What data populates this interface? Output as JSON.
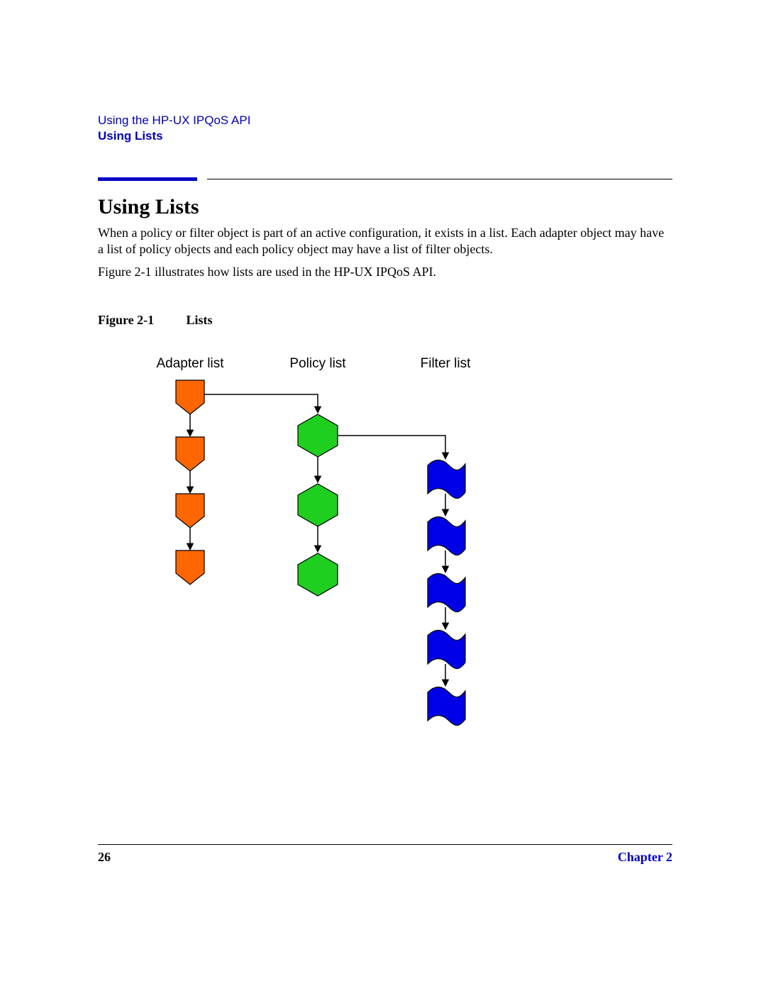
{
  "header": {
    "chapter_path": "Using the HP-UX IPQoS API",
    "section": "Using Lists"
  },
  "section_title": "Using Lists",
  "paragraphs": {
    "p1": "When a policy or filter object is part of an active configuration, it exists in a list. Each adapter object may have a list of policy objects and each policy object may have a list of filter objects.",
    "p2": "Figure 2-1 illustrates how lists are used in the HP-UX IPQoS API."
  },
  "figure": {
    "label": "Figure 2-1",
    "title": "Lists",
    "columns": {
      "adapter": "Adapter list",
      "policy": "Policy list",
      "filter": "Filter list"
    }
  },
  "footer": {
    "page_number": "26",
    "chapter_ref": "Chapter 2"
  },
  "colors": {
    "adapter_fill": "#ff6600",
    "policy_fill": "#1fcf1f",
    "filter_fill": "#0000e6",
    "accent": "#0000c8"
  }
}
